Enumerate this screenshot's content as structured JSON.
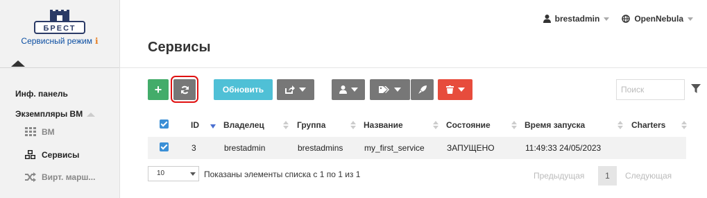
{
  "sidebar": {
    "logo_text": "БРЕСТ",
    "mode_label": "Сервисный режим",
    "mode_info": "ℹ",
    "items": [
      {
        "label": "Инф. панель"
      },
      {
        "label": "Экземпляры ВМ"
      }
    ],
    "subitems": [
      {
        "label": "ВМ",
        "icon": "grid-icon"
      },
      {
        "label": "Сервисы",
        "icon": "cubes-icon",
        "active": true
      },
      {
        "label": "Вирт. марш...",
        "icon": "shuffle-icon"
      }
    ]
  },
  "header": {
    "user": "brestadmin",
    "zone": "OpenNebula"
  },
  "page": {
    "title": "Сервисы"
  },
  "toolbar": {
    "add_label": "+",
    "update_label": "Обновить",
    "search_placeholder": "Поиск"
  },
  "table": {
    "columns": [
      "ID",
      "Владелец",
      "Группа",
      "Название",
      "Состояние",
      "Время запуска",
      "Charters"
    ],
    "rows": [
      {
        "id": "3",
        "owner": "brestadmin",
        "group": "brestadmins",
        "name": "my_first_service",
        "state": "ЗАПУЩЕНО",
        "start_time": "11:49:33 24/05/2023",
        "charters": ""
      }
    ]
  },
  "pager": {
    "page_size": "10",
    "info": "Показаны элементы списка с 1 по 1 из 1",
    "prev": "Предыдущая",
    "current": "1",
    "next": "Следующая"
  },
  "colors": {
    "green": "#43ac6a",
    "teal": "#4fc0d6",
    "grey": "#777777",
    "red": "#e74c3c",
    "checkbox": "#3a8fd6",
    "highlight": "#e01010"
  }
}
